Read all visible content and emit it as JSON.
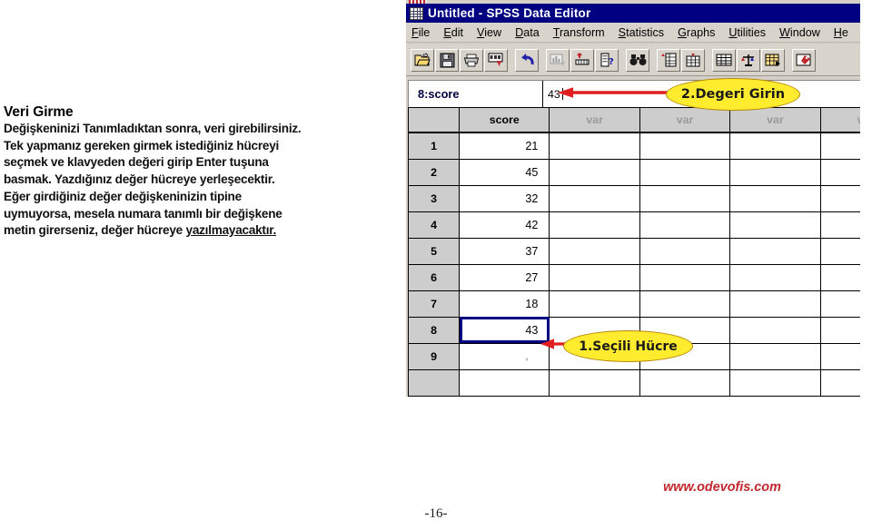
{
  "document": {
    "heading": "Veri Girme",
    "paragraph_lines": [
      "Değişkeninizi Tanımladıktan sonra, veri girebilirsiniz.",
      "Tek yapmanız gereken girmek istediğiniz hücreyi",
      "seçmek ve klavyeden değeri girip Enter tuşuna",
      "basmak.  Yazdığınız değer hücreye yerleşecektir.",
      "Eğer girdiğiniz değer değişkeninizin tipine",
      "uymuyorsa, mesela numara tanımlı bir değişkene",
      "metin girerseniz, değer hücreye "
    ],
    "paragraph_underlined_tail": "yazılmayacaktır.",
    "page_number": "-16-",
    "watermark": "www.odevofis.com"
  },
  "spss": {
    "title": "Untitled - SPSS Data Editor",
    "title_icon": "data-editor-icon",
    "menu": [
      {
        "mnemonic": "F",
        "rest": "ile"
      },
      {
        "mnemonic": "E",
        "rest": "dit"
      },
      {
        "mnemonic": "V",
        "rest": "iew"
      },
      {
        "mnemonic": "D",
        "rest": "ata"
      },
      {
        "mnemonic": "T",
        "rest": "ransform"
      },
      {
        "mnemonic": "S",
        "rest": "tatistics"
      },
      {
        "mnemonic": "G",
        "rest": "raphs"
      },
      {
        "mnemonic": "U",
        "rest": "tilities"
      },
      {
        "mnemonic": "W",
        "rest": "indow"
      },
      {
        "mnemonic": "H",
        "rest": "e"
      }
    ],
    "toolbar_buttons": [
      "open-file-icon",
      "save-file-icon",
      "print-icon",
      "recall-dialog-icon",
      "undo-icon",
      "goto-chart-icon",
      "goto-case-icon",
      "variables-info-icon",
      "find-icon",
      "insert-case-icon",
      "insert-variable-icon",
      "split-file-icon",
      "weight-cases-icon",
      "select-cases-icon",
      "value-labels-icon"
    ],
    "cell_reference": "8:score",
    "cell_value": "43",
    "columns": [
      "score",
      "var",
      "var",
      "var",
      "var"
    ],
    "rows": [
      {
        "num": "1",
        "score": "21"
      },
      {
        "num": "2",
        "score": "45"
      },
      {
        "num": "3",
        "score": "32"
      },
      {
        "num": "4",
        "score": "42"
      },
      {
        "num": "5",
        "score": "37"
      },
      {
        "num": "6",
        "score": "27"
      },
      {
        "num": "7",
        "score": "18"
      },
      {
        "num": "8",
        "score": "43"
      },
      {
        "num": "9",
        "score": ","
      }
    ],
    "selected_row_index": 7,
    "colors": {
      "titlebar": "#000080",
      "selection_border": "#000080",
      "callout_fill": "#ffec2e",
      "callout_border": "#b8860b",
      "arrow": "#e02020",
      "watermark": "#c0272d"
    }
  },
  "annotations": {
    "callout_enter_value": "2.Degeri Girin",
    "callout_selected_cell": "1.Seçili Hücre"
  }
}
